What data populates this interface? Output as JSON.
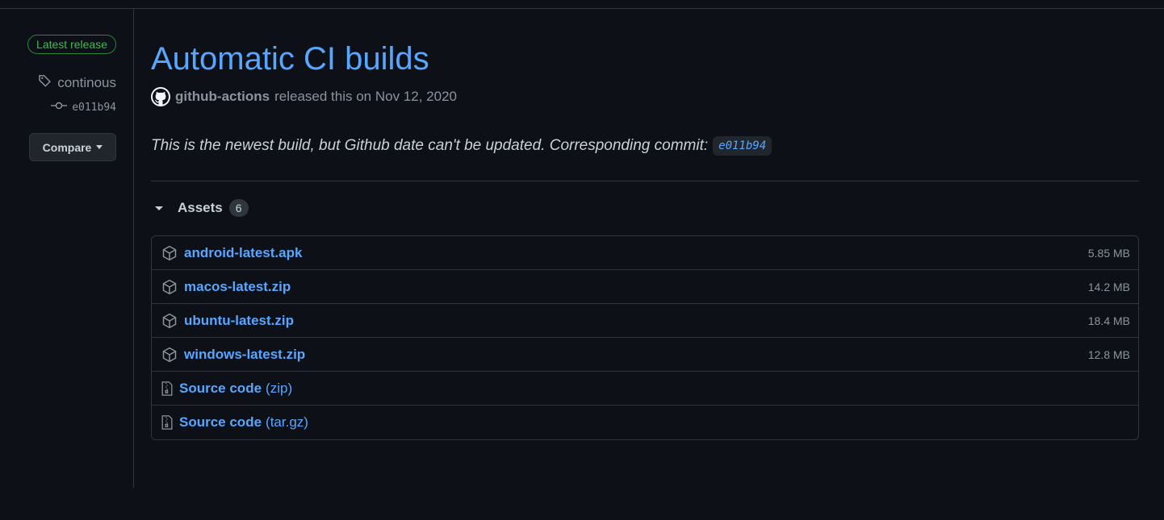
{
  "sidebar": {
    "badge": "Latest release",
    "tag": "continous",
    "commit": "e011b94",
    "compare_label": "Compare"
  },
  "release": {
    "title": "Automatic CI builds",
    "author": "github-actions",
    "released_text": "released this on Nov 12, 2020",
    "description": "This is the newest build, but Github date can't be updated. Corresponding commit:",
    "commit_code": "e011b94"
  },
  "assets": {
    "label": "Assets",
    "count": "6",
    "items": [
      {
        "name": "android-latest.apk",
        "size": "5.85 MB"
      },
      {
        "name": "macos-latest.zip",
        "size": "14.2 MB"
      },
      {
        "name": "ubuntu-latest.zip",
        "size": "18.4 MB"
      },
      {
        "name": "windows-latest.zip",
        "size": "12.8 MB"
      },
      {
        "name": "Source code",
        "suffix": "(zip)"
      },
      {
        "name": "Source code",
        "suffix": "(tar.gz)"
      }
    ]
  },
  "colors": {
    "background": "#0d1117",
    "link": "#58a6ff",
    "badge_green": "#3fb950",
    "muted": "#8b949e",
    "border": "#30363d"
  },
  "icons": [
    "tag-icon",
    "git-commit-icon",
    "github-mark-icon",
    "package-icon",
    "file-zip-icon"
  ]
}
